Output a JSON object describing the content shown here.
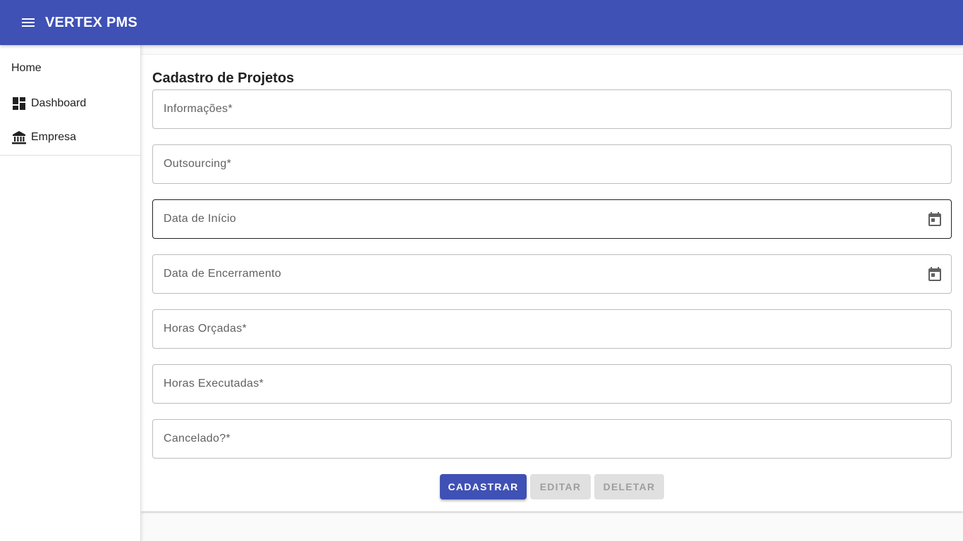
{
  "app": {
    "title": "VERTEX PMS",
    "brand_color": "#3f51b5"
  },
  "sidebar": {
    "home_label": "Home",
    "items": [
      {
        "label": "Dashboard",
        "icon": "dashboard-icon"
      },
      {
        "label": "Empresa",
        "icon": "bank-icon"
      }
    ]
  },
  "form": {
    "title": "Cadastro de Projetos",
    "fields": [
      {
        "label": "Informações*",
        "value": ""
      },
      {
        "label": "Outsourcing*",
        "value": ""
      },
      {
        "label": "Data de Início",
        "value": "",
        "icon": "calendar-icon"
      },
      {
        "label": "Data de Encerramento",
        "value": "",
        "icon": "calendar-icon"
      },
      {
        "label": "Horas Orçadas*",
        "value": ""
      },
      {
        "label": "Horas Executadas*",
        "value": ""
      },
      {
        "label": "Cancelado?*",
        "value": ""
      }
    ],
    "buttons": {
      "submit": "CADASTRAR",
      "edit": "EDITAR",
      "delete": "DELETAR"
    }
  }
}
